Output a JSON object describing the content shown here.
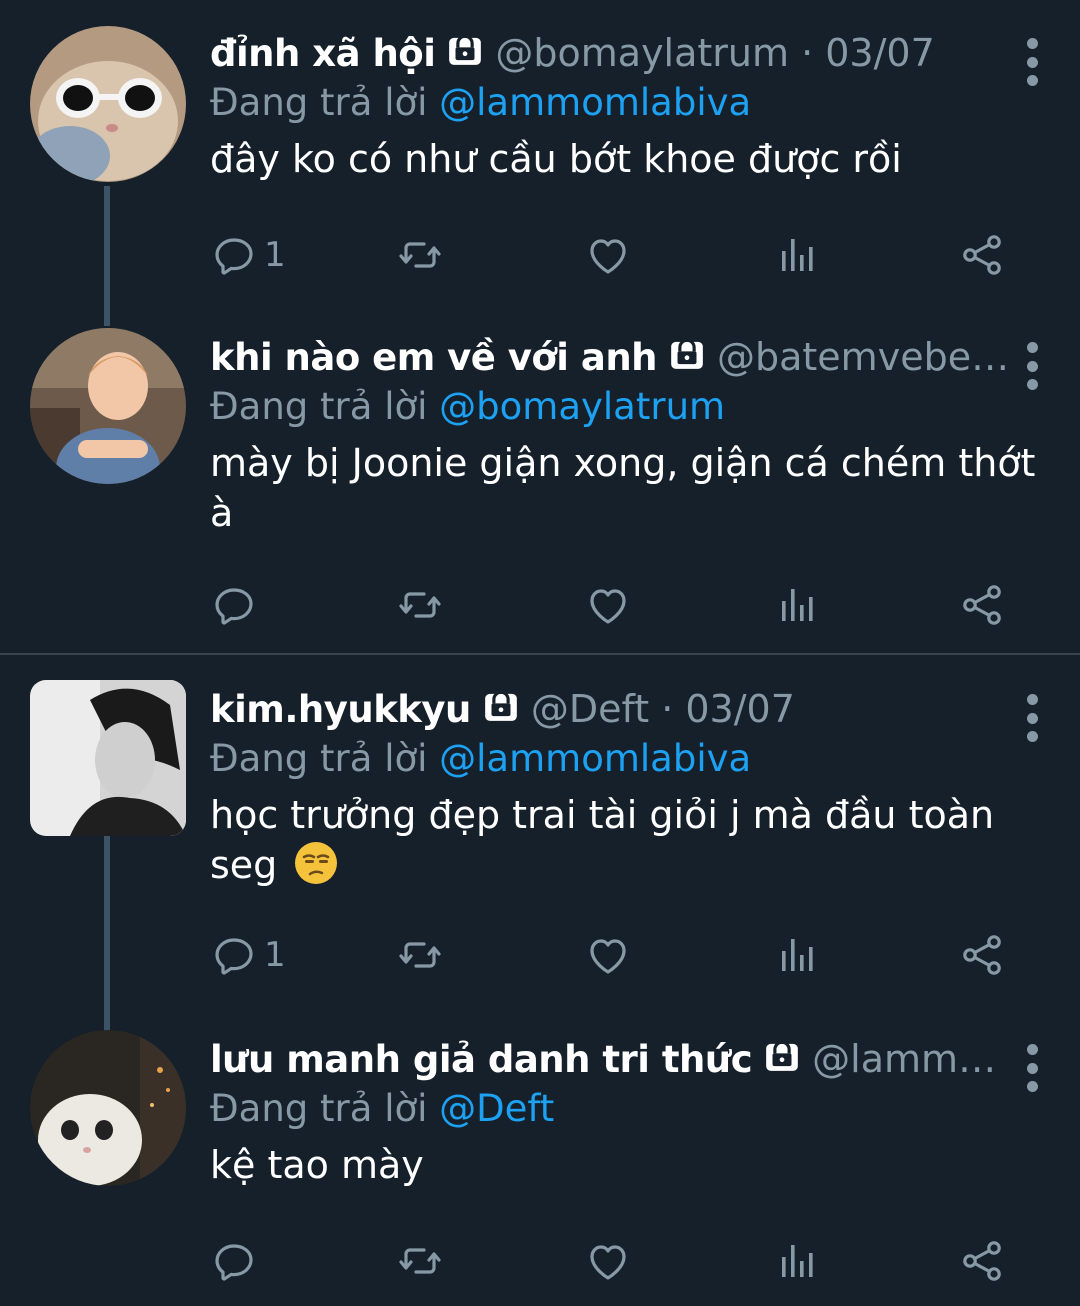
{
  "tweets": [
    {
      "name": "đỉnh xã hội",
      "handle": "@bomaylatrum · 03/07",
      "reply_prefix": "Đang trả lời ",
      "reply_mention": "@lammomlabiva",
      "text": "đây ko có như cầu bớt khoe được rồi",
      "reply_count": "1"
    },
    {
      "name": "khi nào em về với anh",
      "handle": "@batemveben...",
      "reply_prefix": "Đang trả lời ",
      "reply_mention": "@bomaylatrum",
      "text": "mày bị Joonie giận xong, giận cá chém thớt à",
      "reply_count": ""
    },
    {
      "name": "kim.hyukkyu",
      "handle": "@Deft · 03/07",
      "reply_prefix": "Đang trả lời ",
      "reply_mention": "@lammomlabiva",
      "text": "học trưởng đẹp trai tài giỏi j mà đầu toàn seg",
      "reply_count": "1"
    },
    {
      "name": "lưu manh giả danh tri thức",
      "handle": "@lammo...",
      "reply_prefix": "Đang trả lời ",
      "reply_mention": "@Deft",
      "text": "kệ tao mày",
      "reply_count": ""
    }
  ],
  "colors": {
    "background": "#15202b",
    "secondary_text": "#8899a6",
    "mention": "#1da1f2",
    "divider": "#38444d"
  },
  "icons": [
    "lock-icon",
    "more-icon",
    "reply-icon",
    "retweet-icon",
    "like-icon",
    "analytics-icon",
    "share-icon",
    "unamused-face-emoji"
  ]
}
